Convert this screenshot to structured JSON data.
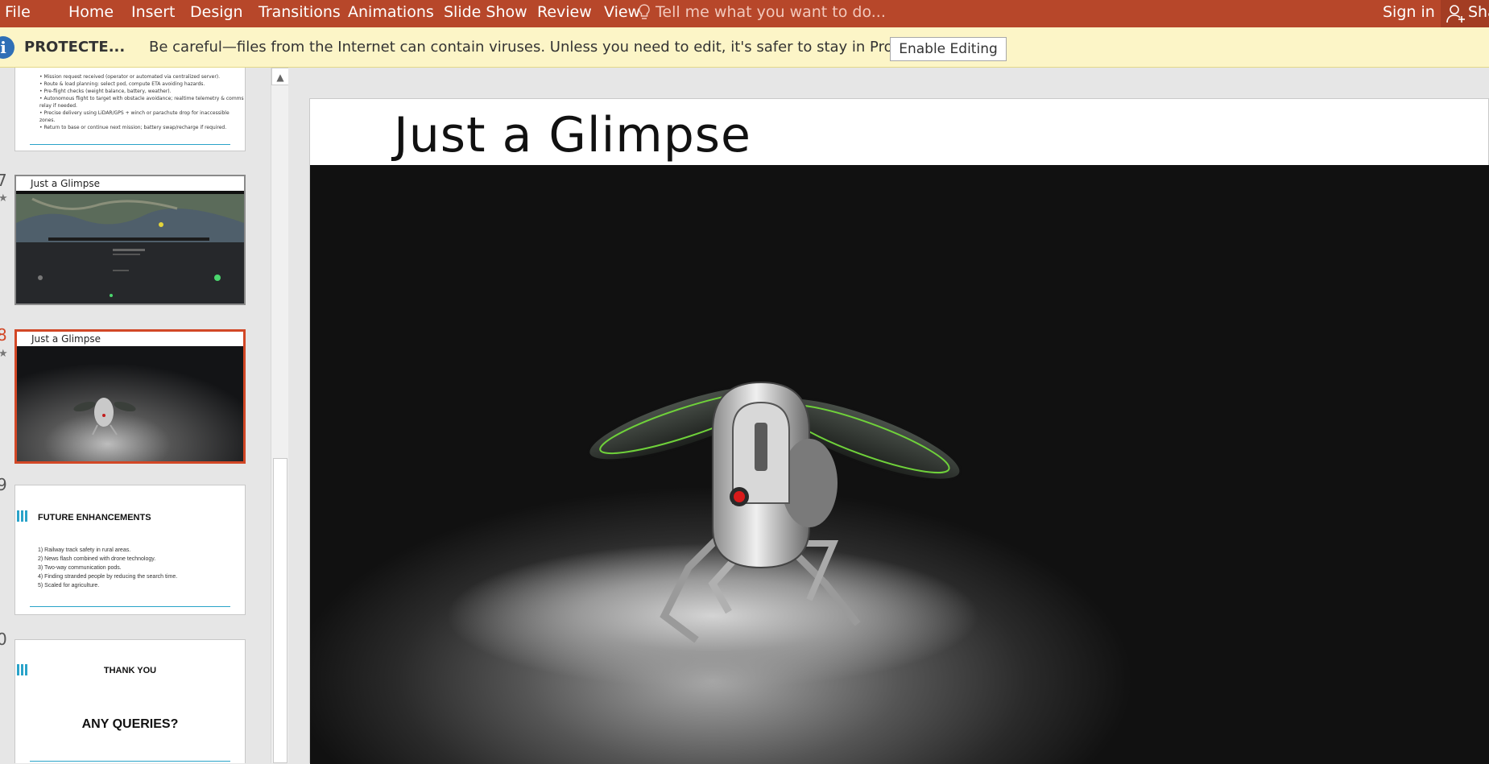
{
  "ribbon": {
    "tabs": [
      "File",
      "Home",
      "Insert",
      "Design",
      "Transitions",
      "Animations",
      "Slide Show",
      "Review",
      "View"
    ],
    "tell_me": "Tell me what you want to do...",
    "sign_in": "Sign in",
    "share": "Sha"
  },
  "protected_bar": {
    "title": "PROTECTE...",
    "message": "Be careful—files from the Internet can contain viruses. Unless you need to edit, it's safer to stay in Protected View.",
    "button": "Enable Editing"
  },
  "thumbnails": {
    "slide6": {
      "bullets": [
        "Mission request received (operator or automated via centralized server).",
        "Route & load planning: select pod, compute ETA avoiding hazards.",
        "Pre-flight checks (weight balance, battery, weather).",
        "Autonomous flight to target with obstacle avoidance; realtime telemetry & comms relay if needed.",
        "Precise delivery using LiDAR/GPS + winch or parachute drop for inaccessible zones.",
        "Return to base or continue next mission; battery swap/recharge if required."
      ]
    },
    "slide7": {
      "num": "7",
      "title": "Just a Glimpse"
    },
    "slide8": {
      "num": "8",
      "title": "Just a Glimpse"
    },
    "slide9": {
      "num": "9",
      "title": "FUTURE ENHANCEMENTS",
      "items": [
        "1)  Railway track safety in rural areas.",
        "2)  News flash combined with drone technology.",
        "3)  Two-way communication pods.",
        "4)  Finding stranded people by reducing the search time.",
        "5)  Scaled for agriculture."
      ]
    },
    "slide10": {
      "num": "0",
      "title": "THANK YOU",
      "subtitle": "ANY QUERIES?"
    }
  },
  "slide": {
    "title": "Just a Glimpse"
  },
  "colors": {
    "ribbon": "#b7472a",
    "accent": "#d24726",
    "protected_bg": "#fcf5c7",
    "slide_line": "#2aa3c9"
  }
}
